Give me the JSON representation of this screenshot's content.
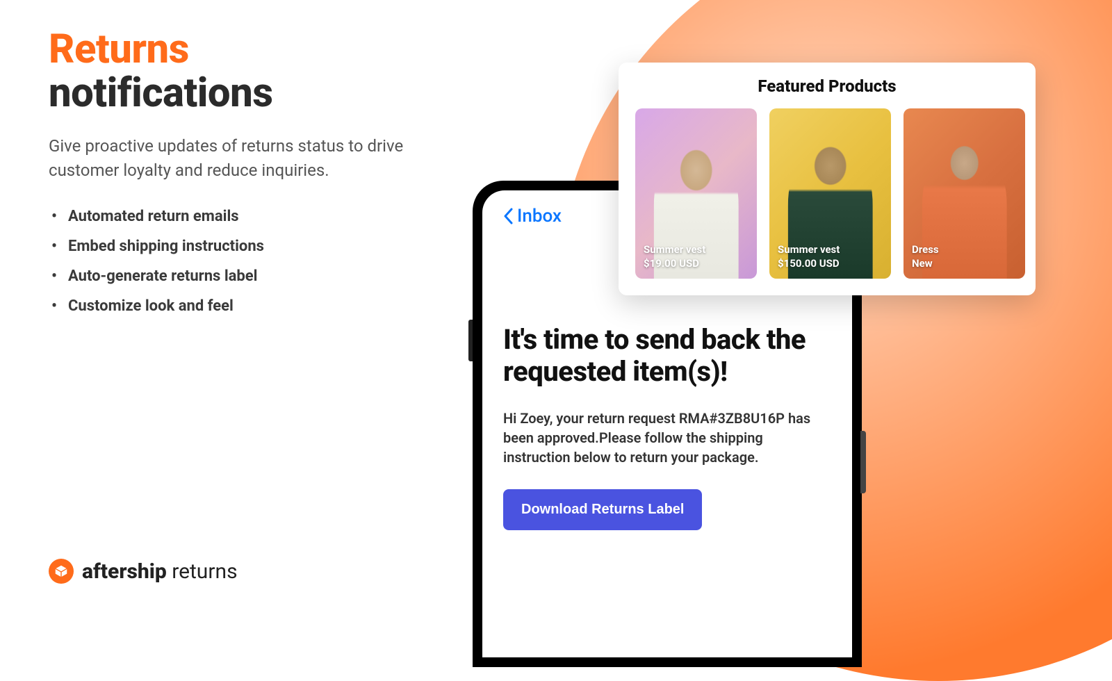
{
  "hero": {
    "title_accent": "Returns",
    "title_rest": "notifications",
    "subtitle": "Give proactive updates of returns status to drive customer loyalty and reduce inquiries.",
    "features": [
      "Automated return emails",
      "Embed shipping instructions",
      "Auto-generate returns label",
      "Customize look and feel"
    ]
  },
  "brand": {
    "bold": "aftership",
    "light": " returns"
  },
  "phone": {
    "inbox_label": "Inbox",
    "email_title": "It's time to send back the requested item(s)!",
    "email_body": "Hi Zoey, your return request RMA#3ZB8U16P has been approved.Please follow the shipping instruction below to return your package.",
    "download_button": "Download Returns Label"
  },
  "featured": {
    "heading": "Featured Products",
    "products": [
      {
        "name": "Summer vest",
        "price": "$19.00 USD"
      },
      {
        "name": "Summer vest",
        "price": "$150.00 USD"
      },
      {
        "name": "Dress",
        "price": "New"
      }
    ]
  }
}
